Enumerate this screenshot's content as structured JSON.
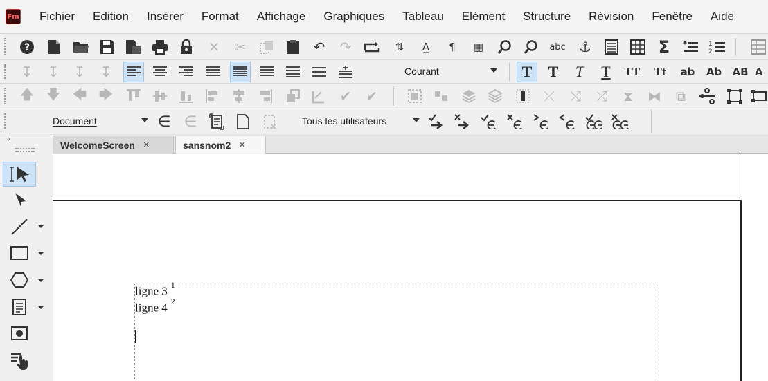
{
  "app": {
    "logo": "Fm"
  },
  "menu": [
    "Fichier",
    "Edition",
    "Insérer",
    "Format",
    "Affichage",
    "Graphiques",
    "Tableau",
    "Elément",
    "Structure",
    "Révision",
    "Fenêtre",
    "Aide"
  ],
  "toolbar": {
    "paragraph_style": "Courant",
    "structure_view": "Document",
    "track_changes_user": "Tous les utilisateurs",
    "char_styles": [
      "T",
      "T",
      "T",
      "T",
      "TT",
      "Tt",
      "ab",
      "Ab",
      "AB",
      "A"
    ]
  },
  "tabs": [
    {
      "label": "WelcomeScreen",
      "close": "×"
    },
    {
      "label": "sansnom2",
      "close": "×"
    }
  ],
  "palette": {
    "collapse": "«"
  },
  "document": {
    "lines": [
      {
        "text": "ligne 3",
        "footnote": "1"
      },
      {
        "text": "ligne 4",
        "footnote": "2"
      }
    ]
  },
  "colors": {
    "active_tool_bg": "#cde3f7",
    "logo_bg": "#3a0b0b",
    "logo_text": "#ff6060"
  }
}
